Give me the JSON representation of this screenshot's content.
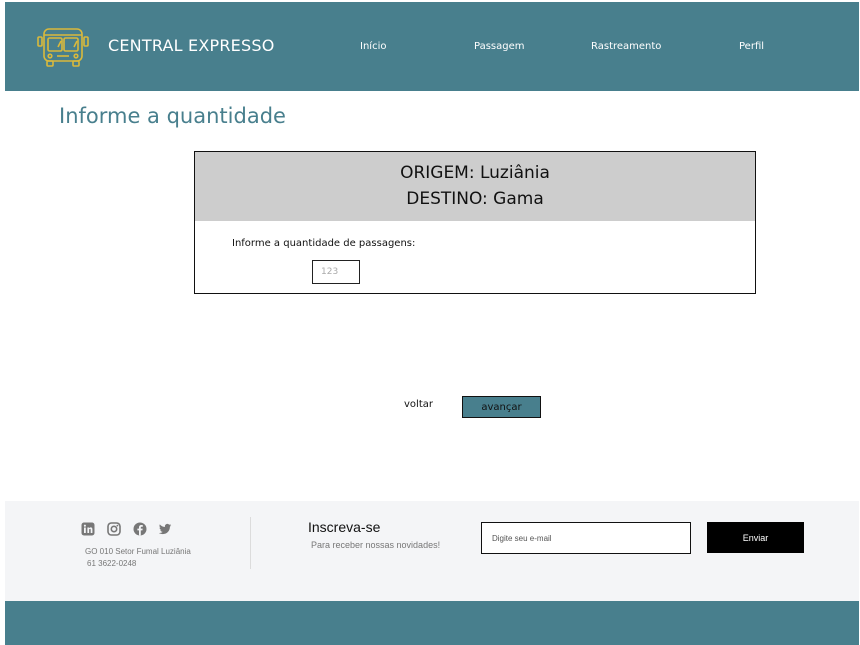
{
  "header": {
    "brand": "CENTRAL EXPRESSO",
    "logo_icon": "bus-icon",
    "nav": [
      {
        "label": "Início"
      },
      {
        "label": "Passagem"
      },
      {
        "label": "Rastreamento"
      },
      {
        "label": "Perfil"
      }
    ]
  },
  "main": {
    "title": "Informe a quantidade",
    "route": {
      "origin": "ORIGEM: Luziânia",
      "destination": "DESTINO: Gama"
    },
    "quantity_label": "Informe a quantidade de passagens:",
    "quantity_placeholder": "123",
    "back_label": "voltar",
    "next_label": "avançar"
  },
  "footer": {
    "social": [
      "linkedin-icon",
      "instagram-icon",
      "facebook-icon",
      "twitter-icon"
    ],
    "address": "GO 010 Setor Fumal Luziânia",
    "phone": "61 3622-0248",
    "subscribe_title": "Inscreva-se",
    "subscribe_text": "Para receber nossas novidades!",
    "email_placeholder": "Digite seu e-mail",
    "send_label": "Enviar"
  },
  "colors": {
    "primary": "#487f8d",
    "logo": "#d9b93c",
    "route_header": "#cdcdcd",
    "footer_bg": "#f4f5f7"
  }
}
